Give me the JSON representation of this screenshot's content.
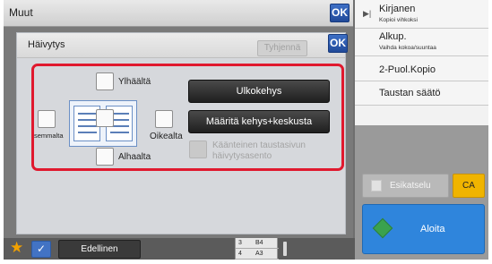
{
  "outer_panel": {
    "title": "Muut",
    "ok_label": "OK"
  },
  "dialog": {
    "title": "Häivytys",
    "clear_label": "Tyhjennä",
    "ok_label": "OK",
    "top_label": "Ylhäältä",
    "left_label": "semmalta",
    "right_label": "Oikealta",
    "bottom_label": "Alhaalta",
    "frame_button": "Ulkokehys",
    "frame_center_button": "Määritä kehys+keskusta",
    "reverse_label": "Käänteinen taustasivun häivytysasento"
  },
  "right_menu": {
    "items": [
      {
        "main": "Kirjanen",
        "sub": "Kopioi vihkoksi"
      },
      {
        "main": "Alkup.",
        "sub": "Vaihda kokoa/suuntaa"
      },
      {
        "main": "2-Puol.Kopio",
        "sub": ""
      },
      {
        "main": "Taustan säätö",
        "sub": ""
      }
    ],
    "preview_label": "Esikatselu",
    "ca_label": "CA",
    "start_label": "Aloita"
  },
  "bottom_bar": {
    "previous_label": "Edellinen",
    "trays": [
      {
        "num": "3",
        "size": "B4"
      },
      {
        "num": "4",
        "size": "A3"
      }
    ]
  },
  "colors": {
    "highlight_frame": "#e0192e",
    "ok_blue": "#2b5bb0",
    "start_blue": "#2f85dc",
    "ca_yellow": "#f0b400",
    "star": "#f2a100"
  }
}
